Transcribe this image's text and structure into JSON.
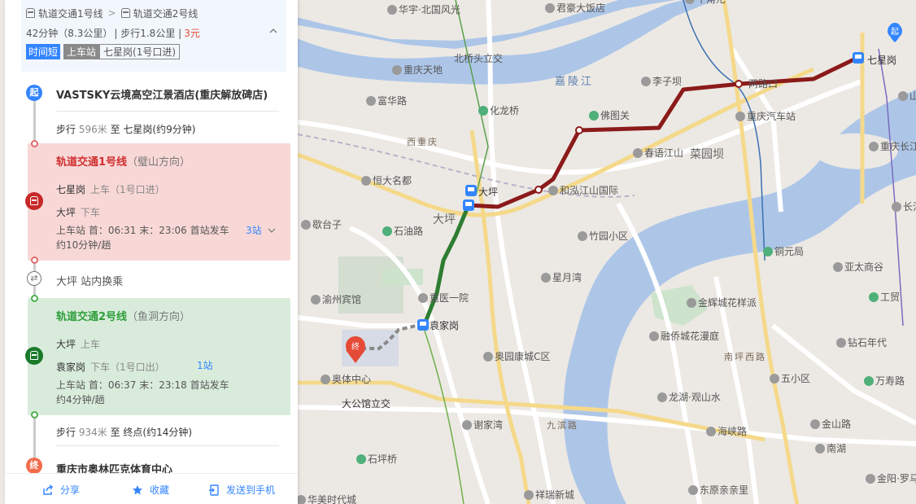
{
  "summary": {
    "line1": "轨道交通1号线",
    "sep": ">",
    "line2": "轨道交通2号线",
    "duration": "42分钟",
    "distance": "（8.3公里）",
    "walk": "| 步行1.8公里 |",
    "price": "3元",
    "tag_fast": "时间短",
    "tag_board": "上车站",
    "tag_station": "七星岗(1号口进)"
  },
  "start": {
    "badge": "起",
    "name": "VASTSKY云境高空江景酒店(重庆解放碑店)",
    "walk_label": "步行",
    "walk_dist": "596米",
    "walk_rest": "至 七星岗(约9分钟)"
  },
  "seg1": {
    "line": "轨道交通1号线",
    "dir": "（璧山方向）",
    "board_station": "七星岗",
    "board_label": "上车（1号口进）",
    "alight_station": "大坪",
    "alight_label": "下车",
    "schedule": "上车站 首：06:31  末：23:06  首站发车",
    "ride": "约10分钟/趟",
    "stops": "3站"
  },
  "transfer": {
    "icon": "⇄",
    "text": "大坪 站内换乘"
  },
  "seg2": {
    "line": "轨道交通2号线",
    "dir": "（鱼洞方向）",
    "board_station": "大坪",
    "board_label": "上车",
    "alight_station": "袁家岗",
    "alight_label": "下车（1号口出）",
    "schedule": "上车站 首：06:37  末：23:18  首站发车",
    "ride": "约4分钟/趟",
    "stops": "1站"
  },
  "end": {
    "walk_label": "步行",
    "walk_dist": "934米",
    "walk_rest": "至 终点(约14分钟)",
    "badge": "终",
    "name": "重庆市奥林匹克体育中心"
  },
  "footer": {
    "share": "分享",
    "fav": "收藏",
    "send": "发送到手机"
  },
  "map": {
    "labels": [
      {
        "t": "华宇·北国风光"
      },
      {
        "t": "君豪大饭店"
      },
      {
        "t": "重庆天地"
      },
      {
        "t": "北桥头立交"
      },
      {
        "t": "嘉陵江"
      },
      {
        "t": "李子坝"
      },
      {
        "t": "两路口"
      },
      {
        "t": "七星岗"
      },
      {
        "t": "山城"
      },
      {
        "t": "富华路"
      },
      {
        "t": "化龙桥"
      },
      {
        "t": "佛图关"
      },
      {
        "t": "重庆汽车站"
      },
      {
        "t": "春语江山"
      },
      {
        "t": "菜园坝"
      },
      {
        "t": "重庆长江"
      },
      {
        "t": "恒大名都"
      },
      {
        "t": "大坪"
      },
      {
        "t": "和泓江山国际"
      },
      {
        "t": "长江"
      },
      {
        "t": "歇台子"
      },
      {
        "t": "石油路"
      },
      {
        "t": "竹园小区"
      },
      {
        "t": "铜元局"
      },
      {
        "t": "亚太商谷"
      },
      {
        "t": "渝州宾馆"
      },
      {
        "t": "星月湾"
      },
      {
        "t": "重医一院"
      },
      {
        "t": "金辉城花样派"
      },
      {
        "t": "工贸"
      },
      {
        "t": "袁家岗"
      },
      {
        "t": "融侨城花漫庭"
      },
      {
        "t": "钻石年代"
      },
      {
        "t": "南坪西路"
      },
      {
        "t": "奥园康城C区"
      },
      {
        "t": "五小区"
      },
      {
        "t": "万寿路"
      },
      {
        "t": "奥体中心"
      },
      {
        "t": "龙湖·观山水"
      },
      {
        "t": "大公馆立交"
      },
      {
        "t": "谢家湾"
      },
      {
        "t": "九滨路"
      },
      {
        "t": "海峡路"
      },
      {
        "t": "金山路"
      },
      {
        "t": "南湖"
      },
      {
        "t": "石坪桥"
      },
      {
        "t": "金阳·罗马假"
      },
      {
        "t": "东原亲亲里"
      },
      {
        "t": "祥瑞新城"
      },
      {
        "t": "华美时代城"
      },
      {
        "t": "牛角沱"
      },
      {
        "t": "西重庆"
      },
      {
        "t": "大坪"
      },
      {
        "t": "起"
      },
      {
        "t": "终"
      }
    ]
  },
  "colors": {
    "line1": "#8b1a1a",
    "line2": "#2e7d32",
    "accent": "#3385ff",
    "red": "#e54a36"
  }
}
